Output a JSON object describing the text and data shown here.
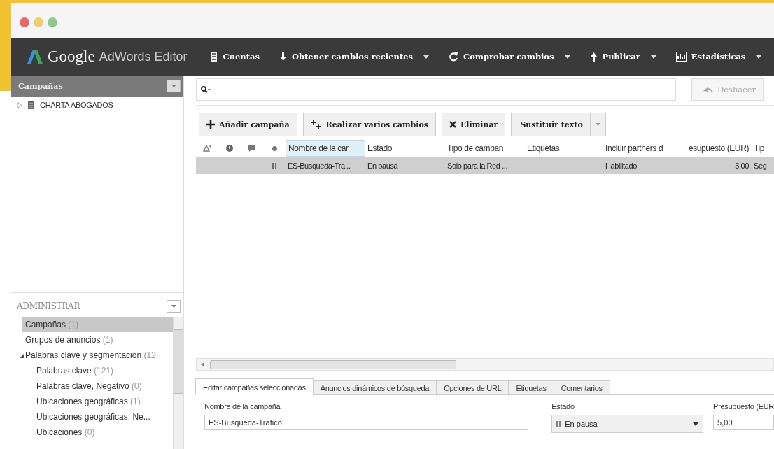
{
  "window": {
    "brand": "Google",
    "product": "AdWords Editor"
  },
  "toolbar": [
    {
      "label": "Cuentas",
      "dropdown": false
    },
    {
      "label": "Obtener cambios recientes",
      "dropdown": true
    },
    {
      "label": "Comprobar cambios",
      "dropdown": true
    },
    {
      "label": "Publicar",
      "dropdown": true
    },
    {
      "label": "Estadísticas",
      "dropdown": true
    }
  ],
  "account_panel": {
    "title": "Campañas",
    "tree": [
      {
        "label": "CHARTA ABOGADOS",
        "expanded": false
      }
    ]
  },
  "manage_panel": {
    "title": "ADMINISTRAR",
    "items": [
      {
        "label": "Campañas",
        "count": "(1)",
        "selected": true
      },
      {
        "label": "Grupos de anuncios",
        "count": "(1)",
        "selected": false
      },
      {
        "label": "Palabras clave y segmentación",
        "count": "(12",
        "selected": false,
        "expanded": true,
        "children": [
          {
            "label": "Palabras clave",
            "count": "(121)",
            "selected": false
          },
          {
            "label": "Palabras clave, Negativo",
            "count": "(0)",
            "selected": false
          },
          {
            "label": "Ubicaciones geográficas",
            "count": "(1)",
            "selected": false
          },
          {
            "label": "Ubicaciones geográficas, Ne...",
            "selected": false
          },
          {
            "label": "Ubicaciones",
            "count": "(0)",
            "selected": false
          }
        ]
      }
    ]
  },
  "undo_button": {
    "label": "Deshacer",
    "disabled": true
  },
  "actions": [
    {
      "label": "Añadir campaña",
      "kind": "add"
    },
    {
      "label": "Realizar varios cambios",
      "kind": "multi"
    },
    {
      "label": "Eliminar",
      "kind": "delete"
    },
    {
      "label": "Sustituir texto",
      "kind": "split"
    }
  ],
  "table": {
    "columns": [
      {
        "label": "Nombre de la car",
        "selected": true,
        "kind": "text"
      },
      {
        "label": "Estado",
        "selected": false,
        "kind": "text"
      },
      {
        "label": "Tipo de campañ",
        "selected": false,
        "kind": "text"
      },
      {
        "label": "Etiquetas",
        "selected": false,
        "kind": "text"
      },
      {
        "label": "Incluir partners d",
        "selected": false,
        "kind": "text"
      },
      {
        "label": "esupuesto (EUR)",
        "selected": false,
        "kind": "number"
      },
      {
        "label": "Tip",
        "selected": false,
        "kind": "text"
      }
    ],
    "rows": [
      {
        "selected": true,
        "paused": true,
        "cells": [
          "ES-Busqueda-Tra...",
          "En pausa",
          "Solo para la Red ...",
          null,
          "Habilitado",
          "5,00",
          "Seg"
        ]
      }
    ]
  },
  "editor": {
    "tabs": [
      {
        "label": "Editar campañas seleccionadas",
        "selected": true
      },
      {
        "label": "Anuncios dinámicos de búsqueda",
        "selected": false
      },
      {
        "label": "Opciones de URL",
        "selected": false
      },
      {
        "label": "Etiquetas",
        "selected": false
      },
      {
        "label": "Comentarios",
        "selected": false
      }
    ],
    "fields": [
      {
        "kind": "text",
        "label": "Nombre de la campaña",
        "value": "ES-Busqueda-Trafico"
      },
      {
        "kind": "select",
        "label": "Estado",
        "value": "En pausa"
      },
      {
        "kind": "text",
        "label": "Presupuesto (EUR",
        "value": "5,00"
      }
    ]
  }
}
